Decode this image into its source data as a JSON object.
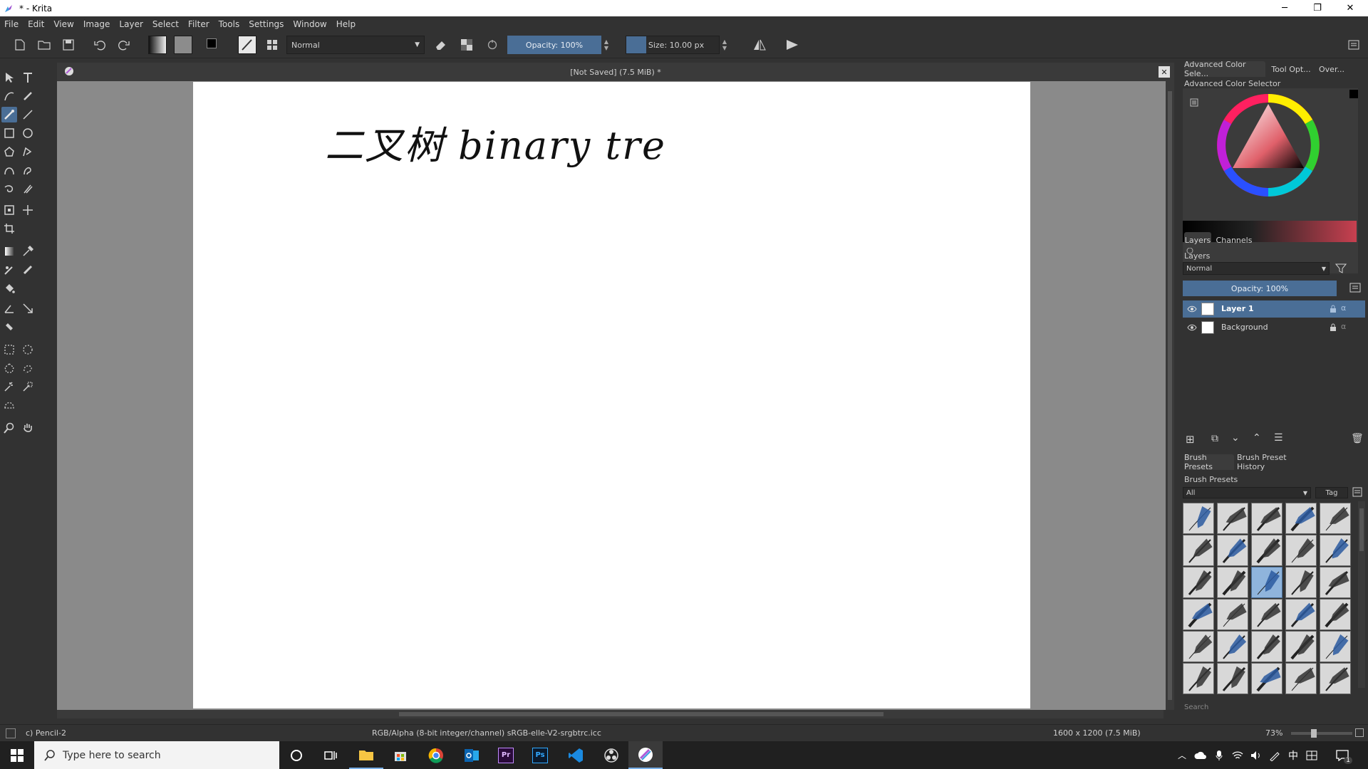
{
  "window": {
    "title": "* - Krita",
    "minimize": "─",
    "restore": "❐",
    "close": "✕"
  },
  "menu": [
    "File",
    "Edit",
    "View",
    "Image",
    "Layer",
    "Select",
    "Filter",
    "Tools",
    "Settings",
    "Window",
    "Help"
  ],
  "toolbar": {
    "blend_mode": "Normal",
    "opacity": "Opacity: 100%",
    "size": "Size: 10.00 px"
  },
  "document": {
    "tab_title": "[Not Saved]  (7.5 MiB) *",
    "handwriting": "二叉树  binary tre"
  },
  "docker_tabs": [
    "Advanced Color Sele...",
    "Tool Opt...",
    "Over..."
  ],
  "color_selector": {
    "title": "Advanced Color Selector"
  },
  "layers_panel": {
    "tabs": [
      "Layers",
      "Channels"
    ],
    "title": "Layers",
    "blend_mode": "Normal",
    "opacity": "Opacity:  100%",
    "layers": [
      {
        "name": "Layer 1",
        "selected": true
      },
      {
        "name": "Background",
        "selected": false
      }
    ]
  },
  "brush_panel": {
    "tabs": [
      "Brush Presets",
      "Brush Preset History"
    ],
    "title": "Brush Presets",
    "filter": "All",
    "tag_label": "Tag",
    "search_placeholder": "Search",
    "selected_index": 12
  },
  "status": {
    "brush_name": "c) Pencil-2",
    "color_profile": "RGB/Alpha (8-bit integer/channel)  sRGB-elle-V2-srgbtrc.icc",
    "image_size": "1600 x 1200 (7.5 MiB)",
    "zoom": "73%"
  },
  "taskbar": {
    "search_placeholder": "Type here to search",
    "ime": "中",
    "notifications_count": "1"
  },
  "colors": {
    "accent": "#4a6e96",
    "bg": "#323232",
    "canvas_bg": "#8a8a8a"
  }
}
